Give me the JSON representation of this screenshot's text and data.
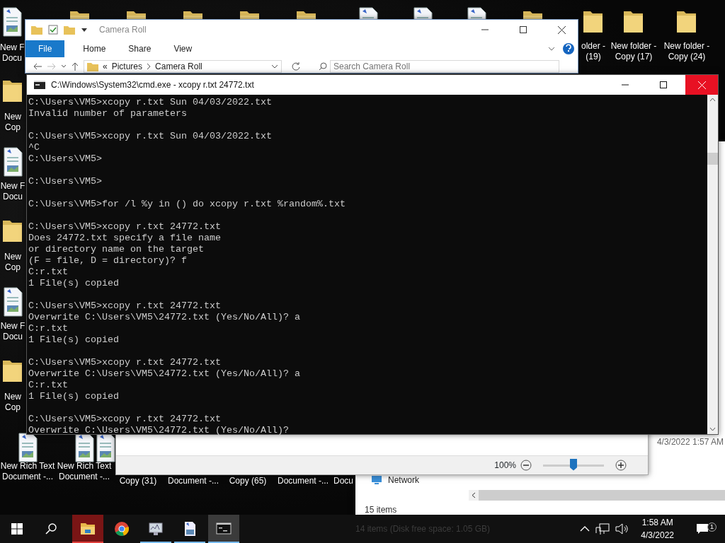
{
  "desktop_icons": [
    {
      "kind": "document",
      "label_lines": [
        "New F",
        "Docu"
      ]
    },
    {
      "kind": "folder"
    },
    {
      "kind": "folder"
    },
    {
      "kind": "folder"
    },
    {
      "kind": "folder"
    },
    {
      "kind": "folder"
    },
    {
      "kind": "document"
    },
    {
      "kind": "document"
    },
    {
      "kind": "document"
    },
    {
      "kind": "folder"
    },
    {
      "kind": "folder",
      "label_lines": [
        "older -",
        "(19)"
      ]
    },
    {
      "kind": "folder",
      "label_lines": [
        "New folder -",
        "Copy (17)"
      ]
    },
    {
      "kind": "folder",
      "label_lines": [
        "New folder -",
        "Copy (24)"
      ]
    },
    {
      "kind": "folder",
      "label_lines": [
        "New",
        "Cop"
      ]
    },
    {
      "kind": "document",
      "label_lines": [
        "New F",
        "Docu"
      ]
    },
    {
      "kind": "folder",
      "label_lines": [
        "New",
        "Cop"
      ]
    },
    {
      "kind": "document",
      "label_lines": [
        "New F",
        "Docu"
      ]
    },
    {
      "kind": "folder",
      "label_lines": [
        "New",
        "Cop"
      ]
    },
    {
      "kind": "document",
      "label_lines": [
        "New Rich Text",
        "Document -..."
      ]
    },
    {
      "kind": "document",
      "label_lines": [
        "New Rich Text",
        "Document -..."
      ]
    },
    {
      "kind": "document"
    },
    {
      "kind": "hidden",
      "label_lines": [
        "Copy (31)"
      ]
    },
    {
      "kind": "hidden",
      "label_lines": [
        "Document -..."
      ]
    },
    {
      "kind": "hidden",
      "label_lines": [
        "Copy (65)"
      ]
    },
    {
      "kind": "hidden",
      "label_lines": [
        "Document -..."
      ]
    },
    {
      "kind": "hidden",
      "label_lines": [
        "Docu"
      ]
    }
  ],
  "explorer": {
    "title": "Camera Roll",
    "ribbon_tabs": [
      {
        "label": "File",
        "selected": true
      },
      {
        "label": "Home",
        "selected": false
      },
      {
        "label": "Share",
        "selected": false
      },
      {
        "label": "View",
        "selected": false
      }
    ],
    "breadcrumb_overflow": "«",
    "breadcrumb": [
      "Pictures",
      "Camera Roll"
    ],
    "search": {
      "placeholder": "Search Camera Roll"
    }
  },
  "console": {
    "title": "C:\\Windows\\System32\\cmd.exe - xcopy  r.txt 24772.txt",
    "close_highlighted": true,
    "blocks": [
      [
        "C:\\Users\\VM5>xcopy r.txt Sun 04/03/2022.txt",
        "Invalid number of parameters"
      ],
      [
        "C:\\Users\\VM5>xcopy r.txt Sun 04/03/2022.txt",
        "^C",
        "C:\\Users\\VM5>"
      ],
      [
        "C:\\Users\\VM5>"
      ],
      [
        "C:\\Users\\VM5>for /l %y in () do xcopy r.txt %random%.txt"
      ],
      [
        "C:\\Users\\VM5>xcopy r.txt 24772.txt",
        "Does 24772.txt specify a file name",
        "or directory name on the target",
        "(F = file, D = directory)? f",
        "C:r.txt",
        "1 File(s) copied"
      ],
      [
        "C:\\Users\\VM5>xcopy r.txt 24772.txt",
        "Overwrite C:\\Users\\VM5\\24772.txt (Yes/No/All)? a",
        "C:r.txt",
        "1 File(s) copied"
      ],
      [
        "C:\\Users\\VM5>xcopy r.txt 24772.txt",
        "Overwrite C:\\Users\\VM5\\24772.txt (Yes/No/All)? a",
        "C:r.txt",
        "1 File(s) copied"
      ],
      [
        "C:\\Users\\VM5>xcopy r.txt 24772.txt",
        "Overwrite C:\\Users\\VM5\\24772.txt (Yes/No/All)?"
      ]
    ]
  },
  "editor_status": {
    "zoom": "100%",
    "level": 0.5
  },
  "explorer_back": {
    "modified": "4/3/2022 1:57 AM",
    "nav_items": [
      {
        "label": "Network"
      }
    ],
    "status": "15 items"
  },
  "taskbar": {
    "apps": [
      {
        "kind": "explorer",
        "selected": false,
        "running": true,
        "attention": true
      },
      {
        "kind": "browser",
        "selected": false,
        "running": false,
        "attention": false
      },
      {
        "kind": "monitor",
        "selected": false,
        "running": true,
        "attention": false
      },
      {
        "kind": "wordpad",
        "selected": false,
        "running": true,
        "attention": false
      },
      {
        "kind": "console",
        "selected": true,
        "running": true,
        "attention": false
      }
    ],
    "ghost_status": "14 items (Disk free space: 1.05 GB)",
    "time": "1:58 AM",
    "date": "4/3/2022",
    "notification_count": "1"
  }
}
